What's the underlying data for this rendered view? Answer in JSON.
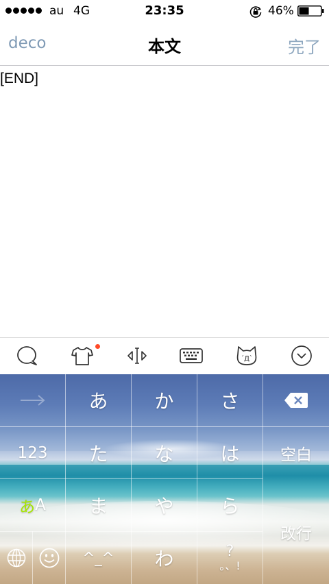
{
  "status_bar": {
    "carrier": "au",
    "network": "4G",
    "time": "23:35",
    "battery_percent": "46%",
    "battery_level": 0.46,
    "icons": [
      "signal-dots-icon",
      "rotation-lock-icon",
      "battery-icon"
    ]
  },
  "nav": {
    "left_label": "deco",
    "title": "本文",
    "right_label": "完了"
  },
  "editor": {
    "text": "[END]"
  },
  "toolbar": {
    "icons": [
      "speech-bubble-icon",
      "tshirt-icon",
      "cursor-move-icon",
      "keyboard-icon",
      "kaomoji-cat-icon",
      "chevron-down-circle-icon"
    ],
    "notice_color": "#ff4a28"
  },
  "keyboard": {
    "row1": {
      "k2": "あ",
      "k3": "か",
      "k4": "さ"
    },
    "row2": {
      "k1": "123",
      "k2": "た",
      "k3": "な",
      "k4": "は",
      "k5": "空白"
    },
    "row3": {
      "k1_green": "あ",
      "k1_rest": "A",
      "k2": "ま",
      "k3": "や",
      "k4": "ら"
    },
    "row4": {
      "k2": "^_^",
      "k3": "わ",
      "k4": "?",
      "k4b": "。、!",
      "k5": "改行"
    },
    "icons": [
      "arrow-right-icon",
      "backspace-icon",
      "globe-icon",
      "emoji-smile-icon"
    ],
    "mode_color": "#a6e600"
  }
}
